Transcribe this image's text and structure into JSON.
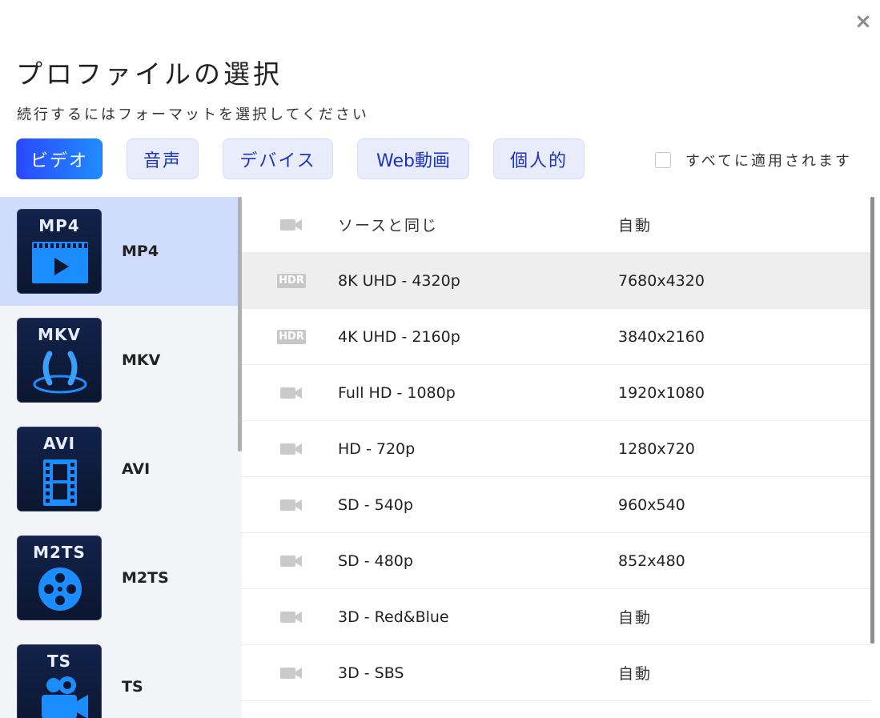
{
  "dialog": {
    "close_label": "×",
    "title": "プロファイルの選択",
    "subtitle": "続行するにはフォーマットを選択してください"
  },
  "tabs": [
    {
      "label": "ビデオ",
      "active": true
    },
    {
      "label": "音声",
      "active": false
    },
    {
      "label": "デバイス",
      "active": false
    },
    {
      "label": "Web動画",
      "active": false
    },
    {
      "label": "個人的",
      "active": false
    }
  ],
  "apply_all": {
    "label": "すべてに適用されます",
    "checked": false
  },
  "formats": [
    {
      "icon_text": "MP4",
      "name": "MP4",
      "icon": "film-play-icon",
      "selected": true
    },
    {
      "icon_text": "MKV",
      "name": "MKV",
      "icon": "matroska-icon",
      "selected": false
    },
    {
      "icon_text": "AVI",
      "name": "AVI",
      "icon": "film-strip-icon",
      "selected": false
    },
    {
      "icon_text": "M2TS",
      "name": "M2TS",
      "icon": "film-reel-icon",
      "selected": false
    },
    {
      "icon_text": "TS",
      "name": "TS",
      "icon": "camera-icon",
      "selected": false
    }
  ],
  "profiles": [
    {
      "icon": "camera-icon",
      "name": "ソースと同じ",
      "resolution": "自動",
      "highlight": false
    },
    {
      "icon": "hdr-badge-icon",
      "badge": "HDR",
      "name": "8K UHD - 4320p",
      "resolution": "7680x4320",
      "highlight": true
    },
    {
      "icon": "hdr-badge-icon",
      "badge": "HDR",
      "name": "4K UHD - 2160p",
      "resolution": "3840x2160",
      "highlight": false
    },
    {
      "icon": "camera-icon",
      "name": "Full HD - 1080p",
      "resolution": "1920x1080",
      "highlight": false
    },
    {
      "icon": "camera-icon",
      "name": "HD - 720p",
      "resolution": "1280x720",
      "highlight": false
    },
    {
      "icon": "camera-icon",
      "name": "SD - 540p",
      "resolution": "960x540",
      "highlight": false
    },
    {
      "icon": "camera-icon",
      "name": "SD - 480p",
      "resolution": "852x480",
      "highlight": false
    },
    {
      "icon": "camera-icon",
      "name": "3D - Red&Blue",
      "resolution": "自動",
      "highlight": false
    },
    {
      "icon": "camera-icon",
      "name": "3D - SBS",
      "resolution": "自動",
      "highlight": false
    }
  ]
}
